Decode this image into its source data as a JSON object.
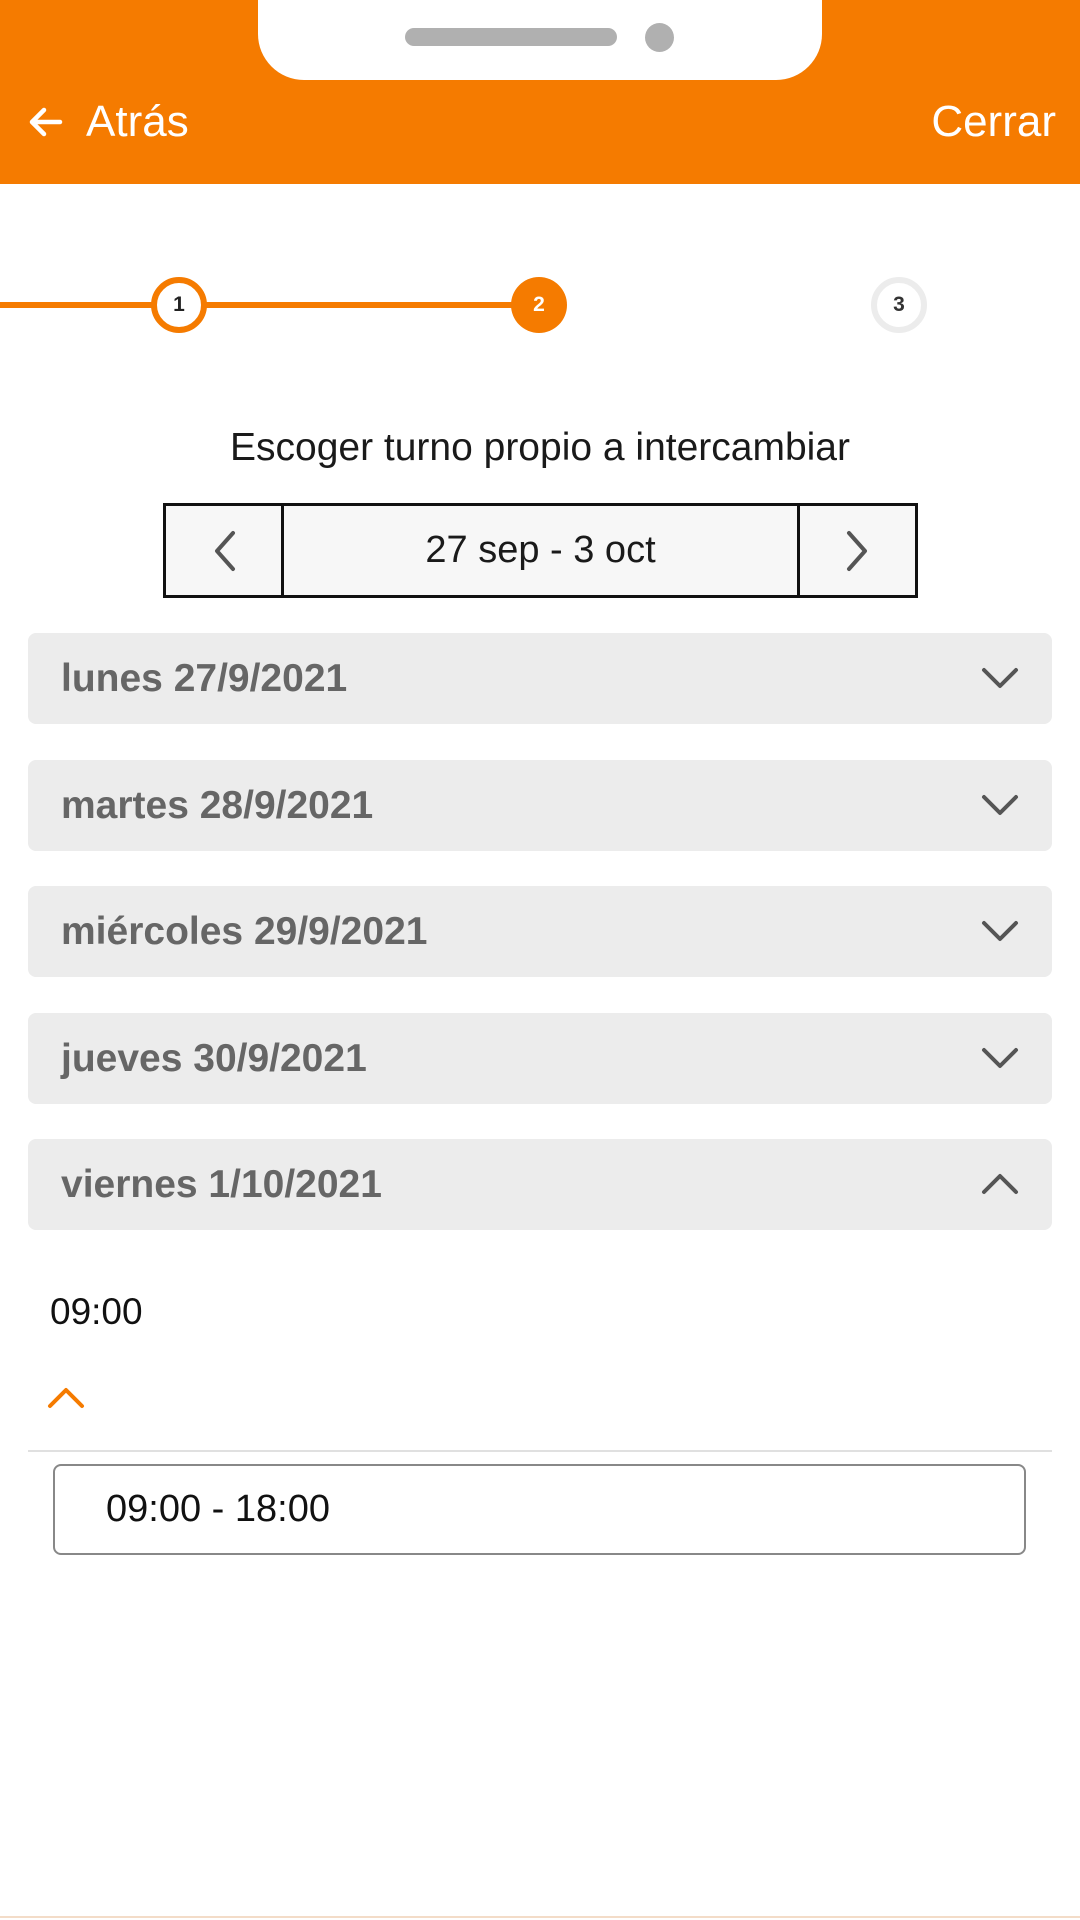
{
  "header": {
    "back_label": "Atrás",
    "close_label": "Cerrar",
    "background_color": "#f57b00"
  },
  "stepper": {
    "steps": [
      {
        "number": "1",
        "state": "completed"
      },
      {
        "number": "2",
        "state": "active"
      },
      {
        "number": "3",
        "state": "pending"
      }
    ],
    "accent_color": "#f57b00"
  },
  "page": {
    "subtitle": "Escoger turno propio a intercambiar"
  },
  "week_selector": {
    "label": "27 sep - 3 oct",
    "prev_icon": "chevron-left-icon",
    "next_icon": "chevron-right-icon"
  },
  "days": [
    {
      "label": "lunes 27/9/2021",
      "expanded": false
    },
    {
      "label": "martes 28/9/2021",
      "expanded": false
    },
    {
      "label": "miércoles 29/9/2021",
      "expanded": false
    },
    {
      "label": "jueves 30/9/2021",
      "expanded": false
    },
    {
      "label": "viernes 1/10/2021",
      "expanded": true
    }
  ],
  "expanded_day": {
    "shift_time": "09:00",
    "options": [
      {
        "label": "09:00 - 18:00"
      }
    ]
  }
}
